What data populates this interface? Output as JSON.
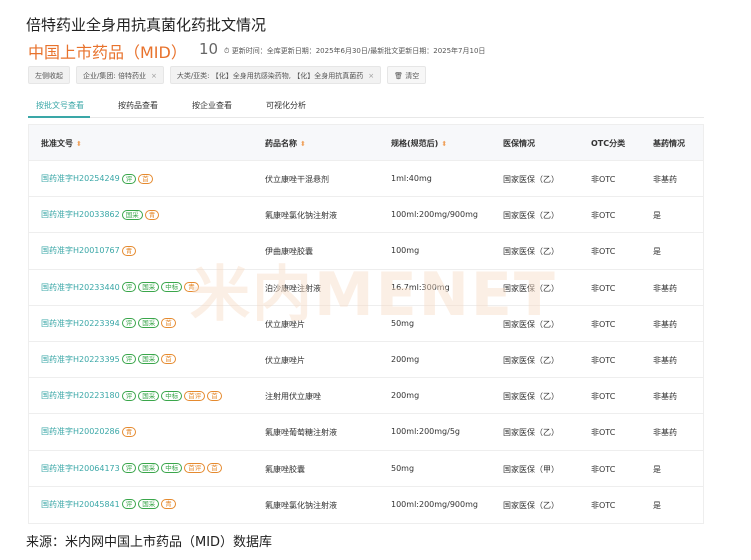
{
  "header": {
    "title": "倍特药业全身用抗真菌化药批文情况",
    "subtitle": "中国上市药品（MID）",
    "count": "10",
    "update_label": "更新时间：",
    "update_text": "全库更新日期：2025年6月30日/最新批文更新日期：2025年7月10日"
  },
  "filters": {
    "chips": [
      {
        "label": "左侧收起"
      },
      {
        "label": "企业/集团: 倍特药业"
      },
      {
        "label": "大类/亚类: 【化】全身用抗感染药物, 【化】全身用抗真菌药"
      },
      {
        "label": "清空"
      }
    ]
  },
  "tabs": [
    {
      "label": "按批文号查看"
    },
    {
      "label": "按药品查看"
    },
    {
      "label": "按企业查看"
    },
    {
      "label": "可视化分析"
    }
  ],
  "table": {
    "headers": {
      "approval": "批准文号",
      "name": "药品名称",
      "spec": "规格(规范后)",
      "insurance": "医保情况",
      "otc": "OTC分类",
      "base": "基药情况"
    },
    "rows": [
      {
        "approval": "国药准字H20254249",
        "badges": [
          "评",
          "首"
        ],
        "name": "伏立康唑干混悬剂",
        "spec": "1ml:40mg",
        "insurance": "国家医保（乙）",
        "otc": "非OTC",
        "base": "非基药"
      },
      {
        "approval": "国药准字H20033862",
        "badges": [
          "国采",
          "青"
        ],
        "name": "氟康唑氯化钠注射液",
        "spec": "100ml:200mg/900mg",
        "insurance": "国家医保（乙）",
        "otc": "非OTC",
        "base": "是"
      },
      {
        "approval": "国药准字H20010767",
        "badges": [
          "青"
        ],
        "name": "伊曲康唑胶囊",
        "spec": "100mg",
        "insurance": "国家医保（乙）",
        "otc": "非OTC",
        "base": "是"
      },
      {
        "approval": "国药准字H20233440",
        "badges": [
          "评",
          "国采",
          "中标",
          "青"
        ],
        "name": "泊沙康唑注射液",
        "spec": "16.7ml:300mg",
        "insurance": "国家医保（乙）",
        "otc": "非OTC",
        "base": "非基药"
      },
      {
        "approval": "国药准字H20223394",
        "badges": [
          "评",
          "国采",
          "首"
        ],
        "name": "伏立康唑片",
        "spec": "50mg",
        "insurance": "国家医保（乙）",
        "otc": "非OTC",
        "base": "非基药"
      },
      {
        "approval": "国药准字H20223395",
        "badges": [
          "评",
          "国采",
          "首"
        ],
        "name": "伏立康唑片",
        "spec": "200mg",
        "insurance": "国家医保（乙）",
        "otc": "非OTC",
        "base": "非基药"
      },
      {
        "approval": "国药准字H20223180",
        "badges": [
          "评",
          "国采",
          "中标",
          "首评",
          "首"
        ],
        "name": "注射用伏立康唑",
        "spec": "200mg",
        "insurance": "国家医保（乙）",
        "otc": "非OTC",
        "base": "非基药"
      },
      {
        "approval": "国药准字H20020286",
        "badges": [
          "青"
        ],
        "name": "氟康唑葡萄糖注射液",
        "spec": "100ml:200mg/5g",
        "insurance": "国家医保（乙）",
        "otc": "非OTC",
        "base": "非基药"
      },
      {
        "approval": "国药准字H20064173",
        "badges": [
          "评",
          "国采",
          "中标",
          "首评",
          "首"
        ],
        "name": "氟康唑胶囊",
        "spec": "50mg",
        "insurance": "国家医保（甲）",
        "otc": "非OTC",
        "base": "是"
      },
      {
        "approval": "国药准字H20045841",
        "badges": [
          "评",
          "国采",
          "青"
        ],
        "name": "氟康唑氯化钠注射液",
        "spec": "100ml:200mg/900mg",
        "insurance": "国家医保（乙）",
        "otc": "非OTC",
        "base": "是"
      }
    ]
  },
  "watermark": "米内MENET",
  "footer": "来源：米内网中国上市药品（MID）数据库"
}
